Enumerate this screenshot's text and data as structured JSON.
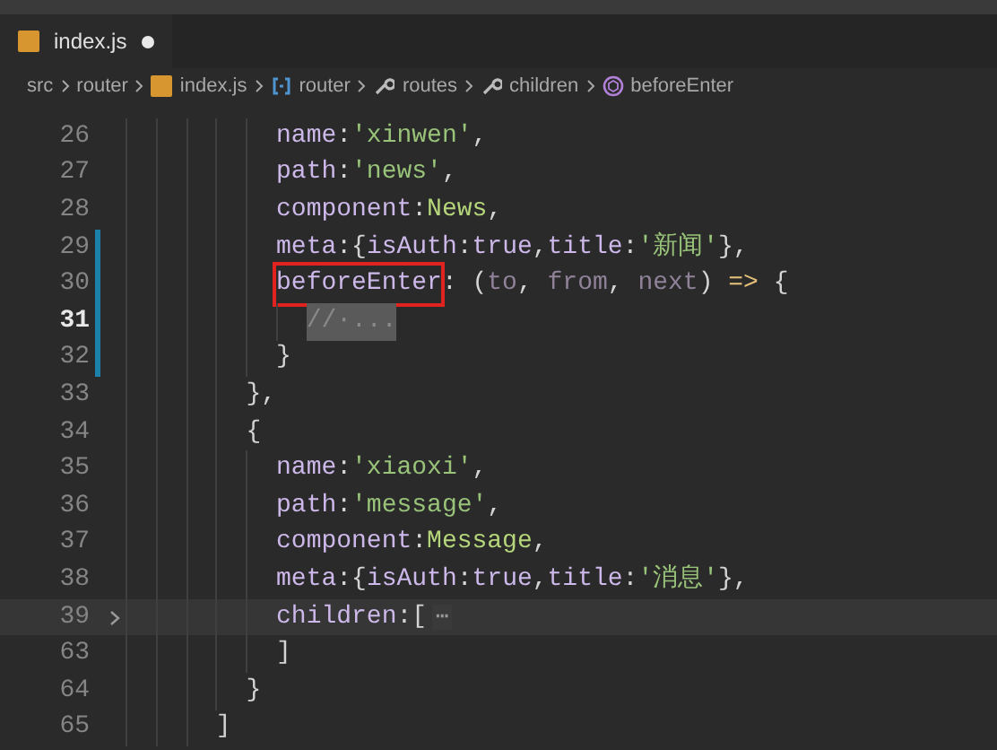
{
  "tab": {
    "label": "index.js",
    "modified": true
  },
  "breadcrumb": [
    {
      "label": "src",
      "kind": "folder"
    },
    {
      "label": "router",
      "kind": "folder"
    },
    {
      "label": "index.js",
      "kind": "file"
    },
    {
      "label": "router",
      "kind": "module"
    },
    {
      "label": "routes",
      "kind": "property"
    },
    {
      "label": "children",
      "kind": "property"
    },
    {
      "label": "beforeEnter",
      "kind": "method"
    }
  ],
  "lines": [
    {
      "number": "26",
      "changed": false,
      "active": false,
      "highlighted": false,
      "foldable": false,
      "tokens": [
        {
          "kind": "key",
          "text": "          name"
        },
        {
          "kind": "punct",
          "text": ":"
        },
        {
          "kind": "string",
          "text": "'xinwen'"
        },
        {
          "kind": "punct",
          "text": ","
        }
      ]
    },
    {
      "number": "27",
      "changed": false,
      "active": false,
      "highlighted": false,
      "foldable": false,
      "tokens": [
        {
          "kind": "key",
          "text": "          path"
        },
        {
          "kind": "punct",
          "text": ":"
        },
        {
          "kind": "string",
          "text": "'news'"
        },
        {
          "kind": "punct",
          "text": ","
        }
      ]
    },
    {
      "number": "28",
      "changed": false,
      "active": false,
      "highlighted": false,
      "foldable": false,
      "tokens": [
        {
          "kind": "key",
          "text": "          component"
        },
        {
          "kind": "punct",
          "text": ":"
        },
        {
          "kind": "class",
          "text": "News"
        },
        {
          "kind": "punct",
          "text": ","
        }
      ]
    },
    {
      "number": "29",
      "changed": true,
      "active": false,
      "highlighted": false,
      "foldable": false,
      "tokens": [
        {
          "kind": "key",
          "text": "          meta"
        },
        {
          "kind": "punct",
          "text": ":{"
        },
        {
          "kind": "key",
          "text": "isAuth"
        },
        {
          "kind": "punct",
          "text": ":"
        },
        {
          "kind": "key",
          "text": "true"
        },
        {
          "kind": "punct",
          "text": ","
        },
        {
          "kind": "key",
          "text": "title"
        },
        {
          "kind": "punct",
          "text": ":"
        },
        {
          "kind": "string",
          "text": "'新闻'"
        },
        {
          "kind": "punct",
          "text": "},"
        }
      ]
    },
    {
      "number": "30",
      "changed": true,
      "active": false,
      "highlighted": false,
      "foldable": false,
      "tokens": [
        {
          "kind": "key",
          "text": "          beforeEnter",
          "boxed": true
        },
        {
          "kind": "punct",
          "text": ": ("
        },
        {
          "kind": "param",
          "text": "to"
        },
        {
          "kind": "punct",
          "text": ", "
        },
        {
          "kind": "param",
          "text": "from"
        },
        {
          "kind": "punct",
          "text": ", "
        },
        {
          "kind": "param",
          "text": "next"
        },
        {
          "kind": "punct",
          "text": ") "
        },
        {
          "kind": "arrow",
          "text": "=>"
        },
        {
          "kind": "punct",
          "text": " {"
        }
      ]
    },
    {
      "number": "31",
      "changed": true,
      "active": true,
      "highlighted": false,
      "foldable": false,
      "tokens": [
        {
          "kind": "comment",
          "text": "            //·...",
          "selected": true
        }
      ]
    },
    {
      "number": "32",
      "changed": true,
      "active": false,
      "highlighted": false,
      "foldable": false,
      "tokens": [
        {
          "kind": "punct",
          "text": "          }"
        }
      ]
    },
    {
      "number": "33",
      "changed": false,
      "active": false,
      "highlighted": false,
      "foldable": false,
      "tokens": [
        {
          "kind": "punct",
          "text": "        },"
        }
      ]
    },
    {
      "number": "34",
      "changed": false,
      "active": false,
      "highlighted": false,
      "foldable": false,
      "tokens": [
        {
          "kind": "punct",
          "text": "        {"
        }
      ]
    },
    {
      "number": "35",
      "changed": false,
      "active": false,
      "highlighted": false,
      "foldable": false,
      "tokens": [
        {
          "kind": "key",
          "text": "          name"
        },
        {
          "kind": "punct",
          "text": ":"
        },
        {
          "kind": "string",
          "text": "'xiaoxi'"
        },
        {
          "kind": "punct",
          "text": ","
        }
      ]
    },
    {
      "number": "36",
      "changed": false,
      "active": false,
      "highlighted": false,
      "foldable": false,
      "tokens": [
        {
          "kind": "key",
          "text": "          path"
        },
        {
          "kind": "punct",
          "text": ":"
        },
        {
          "kind": "string",
          "text": "'message'"
        },
        {
          "kind": "punct",
          "text": ","
        }
      ]
    },
    {
      "number": "37",
      "changed": false,
      "active": false,
      "highlighted": false,
      "foldable": false,
      "tokens": [
        {
          "kind": "key",
          "text": "          component"
        },
        {
          "kind": "punct",
          "text": ":"
        },
        {
          "kind": "class",
          "text": "Message"
        },
        {
          "kind": "punct",
          "text": ","
        }
      ]
    },
    {
      "number": "38",
      "changed": false,
      "active": false,
      "highlighted": false,
      "foldable": false,
      "tokens": [
        {
          "kind": "key",
          "text": "          meta"
        },
        {
          "kind": "punct",
          "text": ":{"
        },
        {
          "kind": "key",
          "text": "isAuth"
        },
        {
          "kind": "punct",
          "text": ":"
        },
        {
          "kind": "key",
          "text": "true"
        },
        {
          "kind": "punct",
          "text": ","
        },
        {
          "kind": "key",
          "text": "title"
        },
        {
          "kind": "punct",
          "text": ":"
        },
        {
          "kind": "string",
          "text": "'消息'"
        },
        {
          "kind": "punct",
          "text": "},"
        }
      ]
    },
    {
      "number": "39",
      "changed": false,
      "active": false,
      "highlighted": true,
      "foldable": true,
      "tokens": [
        {
          "kind": "key",
          "text": "          children"
        },
        {
          "kind": "punct",
          "text": ":["
        },
        {
          "kind": "fold",
          "text": "⋯"
        }
      ]
    },
    {
      "number": "63",
      "changed": false,
      "active": false,
      "highlighted": false,
      "foldable": false,
      "tokens": [
        {
          "kind": "punct",
          "text": "          ]"
        }
      ]
    },
    {
      "number": "64",
      "changed": false,
      "active": false,
      "highlighted": false,
      "foldable": false,
      "tokens": [
        {
          "kind": "punct",
          "text": "        }"
        }
      ]
    },
    {
      "number": "65",
      "changed": false,
      "active": false,
      "highlighted": false,
      "foldable": false,
      "tokens": [
        {
          "kind": "punct",
          "text": "      ]"
        }
      ]
    }
  ]
}
